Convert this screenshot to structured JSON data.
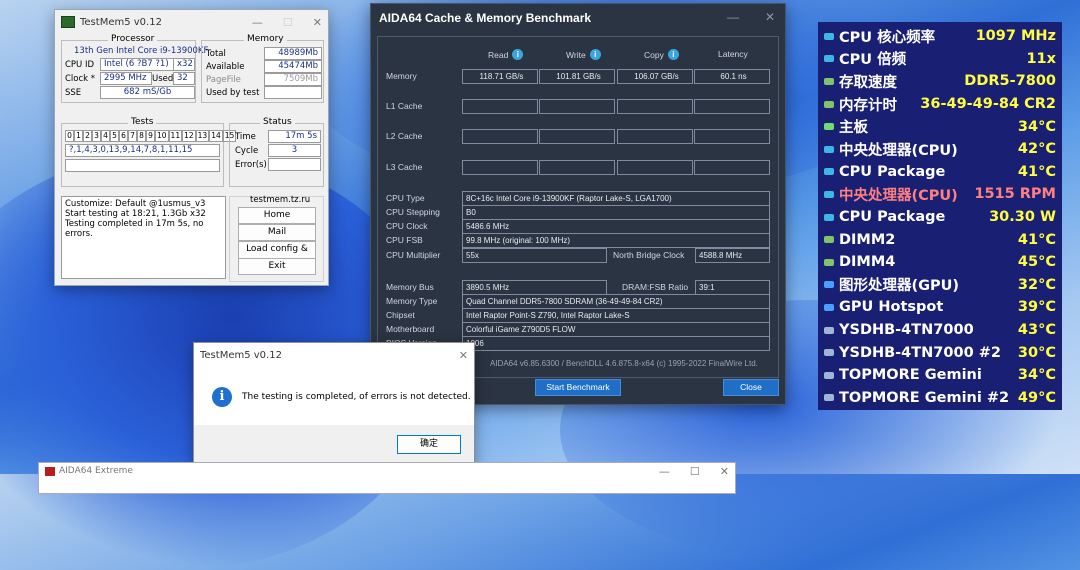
{
  "testmem": {
    "title": "TestMem5 v0.12",
    "processor": {
      "header": "Processor",
      "name": "13th Gen Intel Core i9-13900KF",
      "cpu_id_label": "CPU ID",
      "cpu_id": "Intel (6 ?B7 ?1)",
      "threads": "x32",
      "clock_label": "Clock *",
      "clock": "2995 MHz",
      "used_label": "Used",
      "used": "32",
      "sse_label": "SSE",
      "sse": "682 mS/Gb"
    },
    "memory": {
      "header": "Memory",
      "total_label": "Total",
      "total": "48989Mb",
      "available_label": "Available",
      "available": "45474Mb",
      "pagefile_label": "PageFile",
      "pagefile": "7509Mb",
      "used_by_test_label": "Used by test"
    },
    "tests": {
      "header": "Tests",
      "numbers": [
        "0",
        "1",
        "2",
        "3",
        "4",
        "5",
        "6",
        "7",
        "8",
        "9",
        "10",
        "11",
        "12",
        "13",
        "14",
        "15"
      ],
      "sequence": "?,1,4,3,0,13,9,14,7,8,1,11,15"
    },
    "status": {
      "header": "Status",
      "time_label": "Time",
      "time": "17m 5s",
      "cycle_label": "Cycle",
      "cycle": "3",
      "errors_label": "Error(s)"
    },
    "log": [
      "Customize: Default @1usmus_v3",
      "Start testing at 18:21, 1.3Gb x32",
      "Testing completed in 17m 5s, no errors."
    ],
    "site": "testmem.tz.ru",
    "buttons": {
      "home": "Home",
      "mail": "Mail",
      "load": "Load config & exit",
      "exit": "Exit"
    }
  },
  "aida": {
    "title": "AIDA64 Cache & Memory Benchmark",
    "columns": {
      "read": "Read",
      "write": "Write",
      "copy": "Copy",
      "latency": "Latency"
    },
    "rows": {
      "memory": "Memory",
      "l1": "L1 Cache",
      "l2": "L2 Cache",
      "l3": "L3 Cache"
    },
    "memory_values": {
      "read": "118.71 GB/s",
      "write": "101.81 GB/s",
      "copy": "106.07 GB/s",
      "latency": "60.1 ns"
    },
    "info": [
      {
        "label": "CPU Type",
        "value": "8C+16c Intel Core i9-13900KF  (Raptor Lake-S, LGA1700)"
      },
      {
        "label": "CPU Stepping",
        "value": "B0"
      },
      {
        "label": "CPU Clock",
        "value": "5486.6 MHz"
      },
      {
        "label": "CPU FSB",
        "value": "99.8 MHz  (original: 100 MHz)"
      },
      {
        "label": "CPU Multiplier",
        "value": "55x"
      }
    ],
    "nb_clock_label": "North Bridge Clock",
    "nb_clock": "4588.8 MHz",
    "info2": [
      {
        "label": "Memory Bus",
        "value": "3890.5 MHz"
      },
      {
        "label": "Memory Type",
        "value": "Quad Channel DDR5-7800 SDRAM  (36-49-49-84 CR2)"
      },
      {
        "label": "Chipset",
        "value": "Intel Raptor Point-S Z790, Intel Raptor Lake-S"
      },
      {
        "label": "Motherboard",
        "value": "Colorful iGame Z790D5 FLOW"
      },
      {
        "label": "BIOS Version",
        "value": "1006"
      }
    ],
    "ratio_label": "DRAM:FSB Ratio",
    "ratio": "39:1",
    "footer": "AIDA64 v6.85.6300 / BenchDLL 4.6.875.8-x64  (c) 1995-2022 FinalWire Ltd.",
    "start_button": "Start Benchmark",
    "close_button": "Close"
  },
  "osd": [
    {
      "label": "CPU 核心频率",
      "value": "1097 MHz",
      "icon": "cpu-icon",
      "color": "#ffffff"
    },
    {
      "label": "CPU 倍频",
      "value": "11x",
      "icon": "cpu-icon",
      "color": "#ffffff"
    },
    {
      "label": "存取速度",
      "value": "DDR5-7800",
      "icon": "memory-icon",
      "color": "#ffffff"
    },
    {
      "label": "内存计时",
      "value": "36-49-49-84 CR2",
      "icon": "memory-icon",
      "color": "#ffffff"
    },
    {
      "label": "主板",
      "value": "34°C",
      "icon": "motherboard-icon",
      "color": "#ffffff"
    },
    {
      "label": "中央处理器(CPU)",
      "value": "42°C",
      "icon": "cpu-icon",
      "color": "#ffffff"
    },
    {
      "label": "CPU Package",
      "value": "41°C",
      "icon": "cpu-icon",
      "color": "#ffffff"
    },
    {
      "label": "中央处理器(CPU)",
      "value": "1515 RPM",
      "icon": "cpu-icon",
      "color": "#ff8080"
    },
    {
      "label": "CPU Package",
      "value": "30.30 W",
      "icon": "cpu-icon",
      "color": "#ffffff"
    },
    {
      "label": "DIMM2",
      "value": "41°C",
      "icon": "memory-icon",
      "color": "#ffffff"
    },
    {
      "label": "DIMM4",
      "value": "45°C",
      "icon": "memory-icon",
      "color": "#ffffff"
    },
    {
      "label": "图形处理器(GPU)",
      "value": "32°C",
      "icon": "gpu-icon",
      "color": "#ffffff"
    },
    {
      "label": "GPU Hotspot",
      "value": "39°C",
      "icon": "gpu-icon",
      "color": "#ffffff"
    },
    {
      "label": "YSDHB-4TN7000",
      "value": "43°C",
      "icon": "disk-icon",
      "color": "#ffffff"
    },
    {
      "label": "YSDHB-4TN7000 #2",
      "value": "30°C",
      "icon": "disk-icon",
      "color": "#ffffff"
    },
    {
      "label": "TOPMORE Gemini",
      "value": "34°C",
      "icon": "disk-icon",
      "color": "#ffffff"
    },
    {
      "label": "TOPMORE Gemini #2",
      "value": "49°C",
      "icon": "disk-icon",
      "color": "#ffffff"
    }
  ],
  "dialog": {
    "title": "TestMem5 v0.12",
    "message": "The testing is completed, of errors is not detected.",
    "ok": "确定"
  },
  "aida_main": {
    "title": "AIDA64 Extreme"
  }
}
